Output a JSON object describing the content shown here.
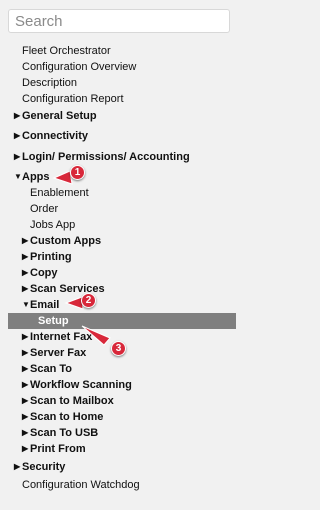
{
  "search": {
    "placeholder": "Search"
  },
  "nav": {
    "items": [
      {
        "label": "Fleet Orchestrator",
        "caret": ""
      },
      {
        "label": "Configuration Overview",
        "caret": ""
      },
      {
        "label": "Description",
        "caret": ""
      },
      {
        "label": "Configuration Report",
        "caret": ""
      },
      {
        "label": "General Setup",
        "caret": "▶"
      },
      {
        "label": "Connectivity",
        "caret": "▶"
      },
      {
        "label": "Login/ Permissions/ Accounting",
        "caret": "▶"
      },
      {
        "label": "Apps",
        "caret": "▼"
      },
      {
        "label": "Enablement",
        "caret": ""
      },
      {
        "label": "Order",
        "caret": ""
      },
      {
        "label": "Jobs App",
        "caret": ""
      },
      {
        "label": "Custom Apps",
        "caret": "▶"
      },
      {
        "label": "Printing",
        "caret": "▶"
      },
      {
        "label": "Copy",
        "caret": "▶"
      },
      {
        "label": "Scan Services",
        "caret": "▶"
      },
      {
        "label": "Email",
        "caret": "▼"
      },
      {
        "label": "Setup",
        "caret": ""
      },
      {
        "label": "Internet Fax",
        "caret": "▶"
      },
      {
        "label": "Server Fax",
        "caret": "▶"
      },
      {
        "label": "Scan To",
        "caret": "▶"
      },
      {
        "label": "Workflow Scanning",
        "caret": "▶"
      },
      {
        "label": "Scan to Mailbox",
        "caret": "▶"
      },
      {
        "label": "Scan to Home",
        "caret": "▶"
      },
      {
        "label": "Scan To USB",
        "caret": "▶"
      },
      {
        "label": "Print From",
        "caret": "▶"
      },
      {
        "label": "Security",
        "caret": "▶"
      },
      {
        "label": "Configuration Watchdog",
        "caret": ""
      }
    ]
  },
  "annotations": [
    {
      "number": "1",
      "target": "Apps"
    },
    {
      "number": "2",
      "target": "Email"
    },
    {
      "number": "3",
      "target": "Setup"
    }
  ],
  "colors": {
    "annotation": "#d8283a",
    "selected_bg": "#7f7f7f",
    "panel_bg": "#f1f1f1"
  }
}
